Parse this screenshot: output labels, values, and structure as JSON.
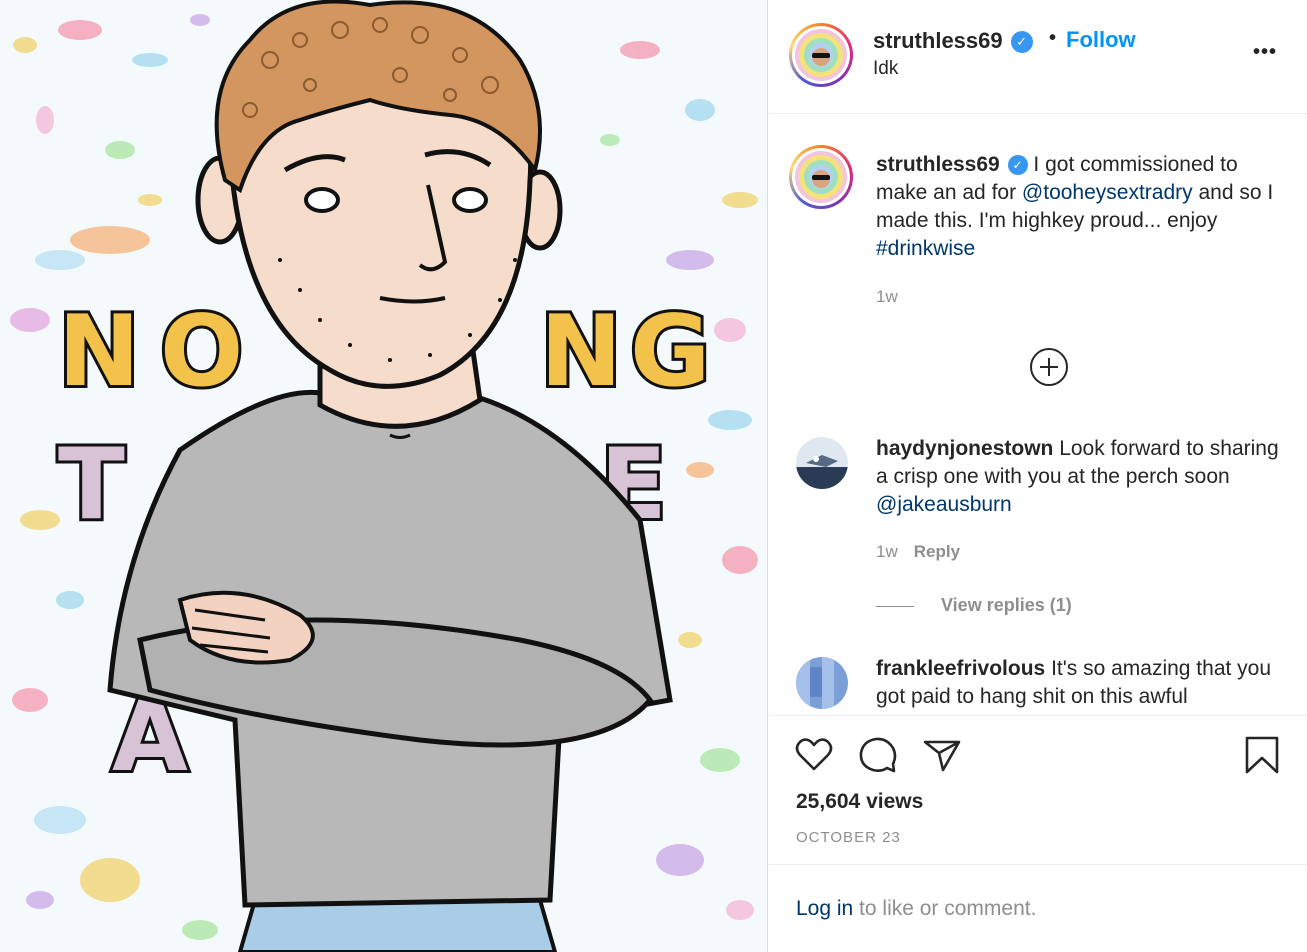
{
  "post": {
    "username": "struthless69",
    "verified_mark": "✓",
    "dot": "•",
    "follow_label": "Follow",
    "location": "Idk",
    "more_label": "•••"
  },
  "media": {
    "art_word_top": "NOTHING",
    "art_word_bottom": "TASTE",
    "palette": {
      "background": "#f4f9fb",
      "hair": "#d4965f",
      "skin": "#f6dccb",
      "shirt": "#b8b8b8",
      "letters_yellow": "#f3c24a",
      "letters_pink": "#d8c2d6"
    }
  },
  "caption": {
    "username": "struthless69",
    "text_before": " I got commissioned to make an ad for ",
    "mention": "@tooheysextradry",
    "text_middle": " and so I made this. I'm highkey proud... enjoy ",
    "hashtag": "#drinkwise",
    "time": "1w"
  },
  "load_more_icon": "plus-circle-icon",
  "comments": [
    {
      "username": "haydynjonestown",
      "text_before": " Look forward to sharing a crisp one with you at the perch soon ",
      "mention": "@jakeausburn",
      "time": "1w",
      "reply_label": "Reply",
      "view_replies": "View replies (1)"
    },
    {
      "username": "frankleefrivolous",
      "text_before": " It's so amazing that you got paid to hang shit on this awful"
    }
  ],
  "actions": {
    "like_icon": "heart-icon",
    "comment_icon": "comment-icon",
    "share_icon": "paper-plane-icon",
    "save_icon": "bookmark-icon",
    "views": "25,604 views",
    "date": "OCTOBER 23"
  },
  "login": {
    "link": "Log in",
    "text": " to like or comment."
  },
  "colors": {
    "accent": "#0095f6",
    "link": "#00376b",
    "muted": "#8e8e8e",
    "text": "#262626",
    "verified": "#3897f0"
  }
}
